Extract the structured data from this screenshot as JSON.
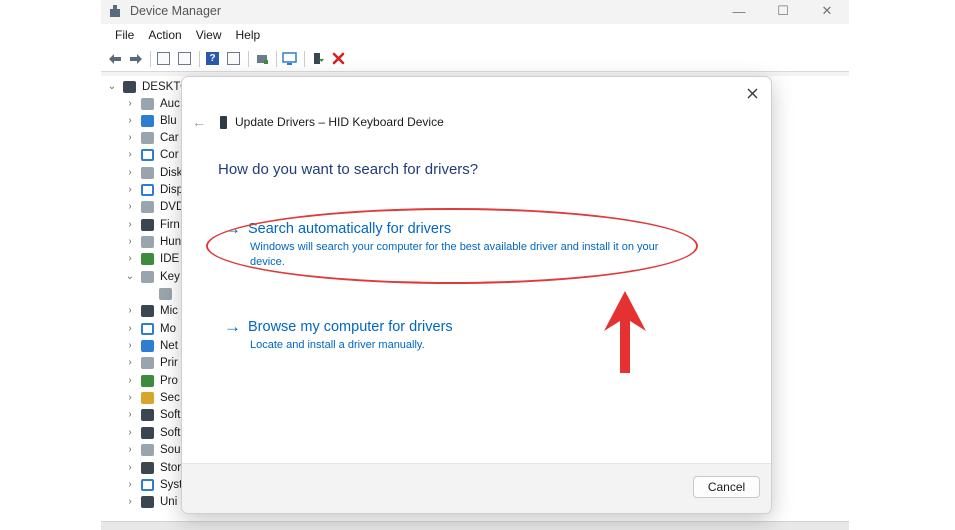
{
  "window": {
    "title": "Device Manager",
    "controls": {
      "minimize": "—",
      "maximize": "☐",
      "close": "✕"
    }
  },
  "menu": [
    "File",
    "Action",
    "View",
    "Help"
  ],
  "tree": {
    "root": "DESKTO",
    "items": [
      {
        "label": "Auc",
        "expanded": false
      },
      {
        "label": "Blu",
        "expanded": false
      },
      {
        "label": "Car",
        "expanded": false
      },
      {
        "label": "Cor",
        "expanded": false
      },
      {
        "label": "Disk",
        "expanded": false
      },
      {
        "label": "Disp",
        "expanded": false
      },
      {
        "label": "DVD",
        "expanded": false
      },
      {
        "label": "Firn",
        "expanded": false
      },
      {
        "label": "Hun",
        "expanded": false
      },
      {
        "label": "IDE",
        "expanded": false
      },
      {
        "label": "Key",
        "expanded": true
      },
      {
        "label": "",
        "expanded": false,
        "child": true
      },
      {
        "label": "Mic",
        "expanded": false
      },
      {
        "label": "Mo",
        "expanded": false
      },
      {
        "label": "Net",
        "expanded": false
      },
      {
        "label": "Prir",
        "expanded": false
      },
      {
        "label": "Pro",
        "expanded": false
      },
      {
        "label": "Sec",
        "expanded": false
      },
      {
        "label": "Soft",
        "expanded": false
      },
      {
        "label": "Soft",
        "expanded": false
      },
      {
        "label": "Sou",
        "expanded": false
      },
      {
        "label": "Stor",
        "expanded": false
      },
      {
        "label": "Syst",
        "expanded": false
      },
      {
        "label": "Uni",
        "expanded": false
      }
    ]
  },
  "dialog": {
    "header": "Update Drivers – HID Keyboard Device",
    "question": "How do you want to search for drivers?",
    "option_auto": {
      "title": "Search automatically for drivers",
      "desc": "Windows will search your computer for the best available driver and install it on your device."
    },
    "option_browse": {
      "title": "Browse my computer for drivers",
      "desc": "Locate and install a driver manually."
    },
    "cancel": "Cancel"
  },
  "annotation_color": "#e03a3a"
}
